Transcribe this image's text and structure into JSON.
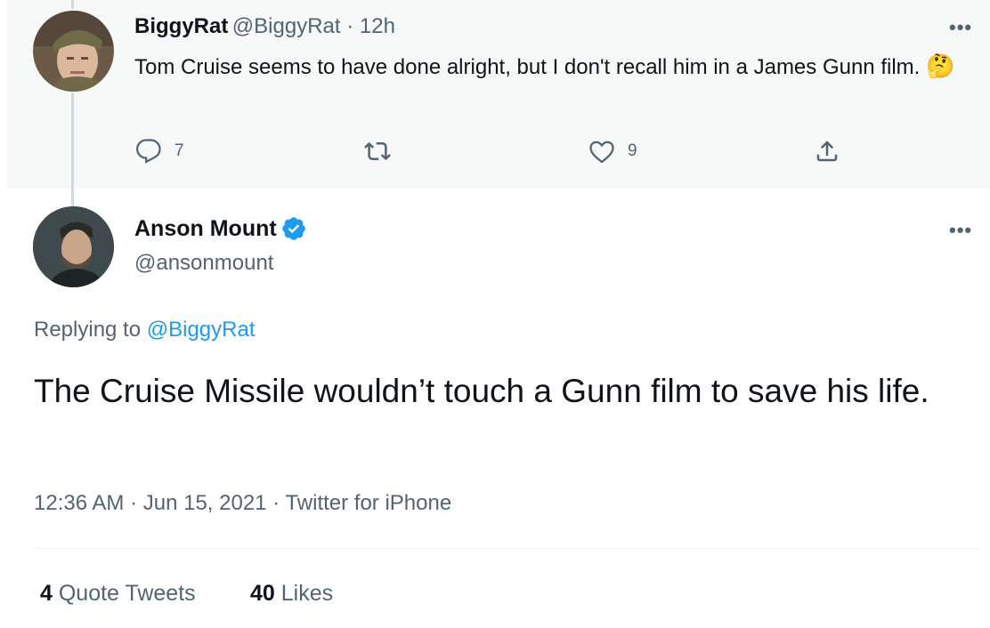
{
  "parent_tweet": {
    "display_name": "BiggyRat",
    "handle": "@BiggyRat",
    "separator": " · ",
    "time_ago": "12h",
    "text": "Tom Cruise seems to have done alright,  but I don't recall him in a James Gunn film.",
    "emoji": "🤔",
    "more_label": "•••",
    "reply_count": "7",
    "like_count": "9"
  },
  "main_tweet": {
    "display_name": "Anson Mount",
    "handle": "@ansonmount",
    "verified": true,
    "more_label": "•••",
    "replying_prefix": "Replying to ",
    "replying_to": "@BiggyRat",
    "text": "The Cruise Missile wouldn’t touch a Gunn film to save his life.",
    "time": "12:36 AM",
    "dot1": " · ",
    "date": "Jun 15, 2021",
    "dot2": " · ",
    "source": "Twitter for iPhone",
    "quote_tweets_count": "4",
    "quote_tweets_label": " Quote Tweets",
    "likes_count": "40",
    "likes_label": " Likes"
  },
  "colors": {
    "accent": "#1d9bf0",
    "secondary_text": "#536471",
    "primary_text": "#0f1419",
    "parent_background": "#f7f9f9"
  },
  "icons": [
    "reply-icon",
    "retweet-icon",
    "like-icon",
    "share-icon",
    "verified-badge-icon",
    "more-icon"
  ]
}
